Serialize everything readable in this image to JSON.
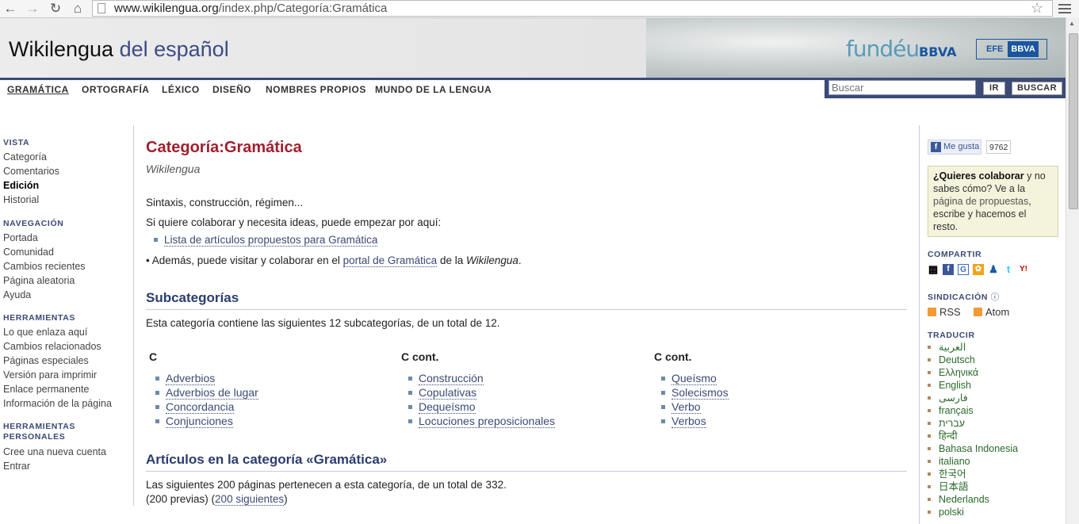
{
  "browser": {
    "url_host": "www.wikilengua.org",
    "url_path": "/index.php/Categoría:Gramática"
  },
  "header": {
    "logo_main": "Wikilengua",
    "logo_tail": "del español",
    "fundeu": "fundéu",
    "fundeu_bbva": "BBVA",
    "efe": "EFE",
    "efe_bbva": "BBVA"
  },
  "topnav": [
    {
      "label": "GRAMÁTICA"
    },
    {
      "label": "ORTOGRAFÍA"
    },
    {
      "label": "LÉXICO"
    },
    {
      "label": "DISEÑO"
    },
    {
      "label": "NOMBRES PROPIOS"
    },
    {
      "label": "MUNDO DE LA LENGUA"
    }
  ],
  "search": {
    "placeholder": "Buscar",
    "go_label": "IR",
    "search_label": "BUSCAR"
  },
  "sidebar": {
    "vista": {
      "heading": "VISTA",
      "items": [
        "Categoría",
        "Comentarios",
        "Edición",
        "Historial"
      ]
    },
    "navegacion": {
      "heading": "NAVEGACIÓN",
      "items": [
        "Portada",
        "Comunidad",
        "Cambios recientes",
        "Página aleatoria",
        "Ayuda"
      ]
    },
    "herramientas": {
      "heading": "HERRAMIENTAS",
      "items": [
        "Lo que enlaza aquí",
        "Cambios relacionados",
        "Páginas especiales",
        "Versión para imprimir",
        "Enlace permanente",
        "Información de la página"
      ]
    },
    "personales": {
      "heading_1": "HERRAMIENTAS",
      "heading_2": "PERSONALES",
      "items": [
        "Cree una nueva cuenta",
        "Entrar"
      ]
    }
  },
  "content": {
    "title": "Categoría:Gramática",
    "site_sub": "Wikilengua",
    "intro": "Sintaxis, construcción, régimen...",
    "collab_text": "Si quiere colaborar y necesita ideas, puede empezar por aquí:",
    "proposals_link": "Lista de artículos propuestos para Gramática",
    "portal_pre": "• Además, puede visitar y colaborar en el ",
    "portal_link": "portal de Gramática",
    "portal_mid": " de la ",
    "portal_em": "Wikilengua",
    "portal_post": ".",
    "subcat_heading": "Subcategorías",
    "subcat_text": "Esta categoría contiene las siguientes 12 subcategorías, de un total de 12.",
    "columns": [
      {
        "heading": "C",
        "items": [
          "Adverbios",
          "Adverbios de lugar",
          "Concordancia",
          "Conjunciones"
        ]
      },
      {
        "heading": "C cont.",
        "items": [
          "Construcción",
          "Copulativas",
          "Dequeísmo",
          "Locuciones preposicionales"
        ]
      },
      {
        "heading": "C cont.",
        "items": [
          "Queísmo",
          "Solecismos",
          "Verbo",
          "Verbos"
        ]
      }
    ],
    "articles_heading": "Artículos en la categoría «Gramática»",
    "articles_text": "Las siguientes 200 páginas pertenecen a esta categoría, de un total de 332.",
    "prev_text": "(200 previas) (",
    "next_link": "200 siguientes",
    "next_close": ")"
  },
  "rightbar": {
    "like_label": "Me gusta",
    "like_count": "9762",
    "collab_q": "¿Quieres colaborar",
    "collab_rest": " y no sabes cómo? Ve a la ",
    "collab_link": "página de propuestas",
    "collab_end": ", escribe y hacemos el resto.",
    "compartir": "COMPARTIR",
    "sindicacion": "SINDICACIÓN",
    "rss": "RSS",
    "atom": "Atom",
    "traducir": "TRADUCIR",
    "languages": [
      "العربية",
      "Deutsch",
      "Ελληνικά",
      "English",
      "فارسی",
      "français",
      "עברית",
      "हिन्दी",
      "Bahasa Indonesia",
      "italiano",
      "한국어",
      "日本語",
      "Nederlands",
      "polski"
    ]
  }
}
